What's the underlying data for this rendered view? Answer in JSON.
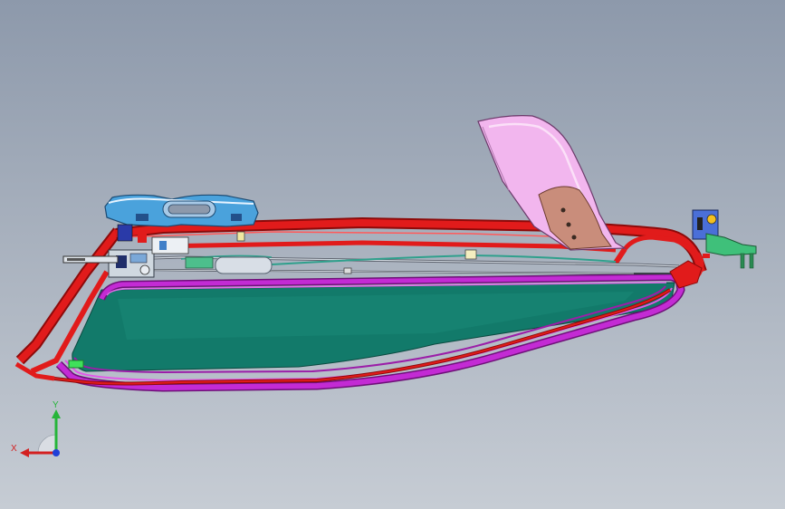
{
  "viewport": {
    "background_top": "#8d99ab",
    "background_bottom": "#c6ccd4"
  },
  "model": {
    "colors": {
      "frame_red": "#e11b1b",
      "frame_red_dark": "#8c0a0a",
      "seal_magenta": "#c32bd4",
      "seal_magenta_dark": "#6e1178",
      "glass_teal": "#127a6a",
      "glass_teal_light": "#2fa08c",
      "motor_blue": "#4aa2dc",
      "panel_pink": "#f2b6ee",
      "bracket_tan": "#c98d7b",
      "bracket_green": "#3fc07a"
    }
  },
  "triad": {
    "x_label": "X",
    "y_label": "Y",
    "x_color": "#d32020",
    "y_color": "#26b53a",
    "z_color": "#2040d8"
  }
}
